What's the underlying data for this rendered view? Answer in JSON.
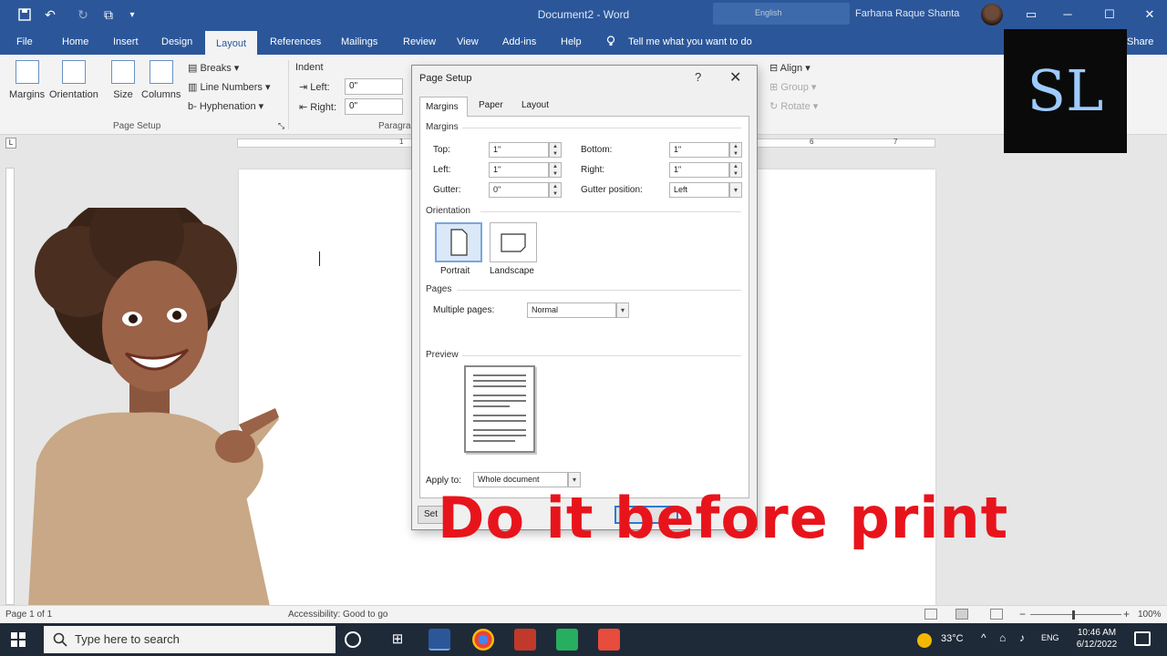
{
  "window": {
    "doc_title": "Document2  -  Word",
    "search_hint": "English",
    "user_name": "Farhana Raque Shanta",
    "minimize": "─",
    "restore": "☐",
    "close": "✕"
  },
  "tabs": [
    "File",
    "Home",
    "Insert",
    "Design",
    "Layout",
    "References",
    "Mailings",
    "Review",
    "View",
    "Add-ins",
    "Help"
  ],
  "tell_me": "Tell me what you want to do",
  "share": "Share",
  "ribbon": {
    "margins": "Margins",
    "orientation": "Orientation",
    "size": "Size",
    "columns": "Columns",
    "breaks": "Breaks",
    "line_numbers": "Line Numbers",
    "hyphenation": "Hyphenation",
    "page_setup_group": "Page Setup",
    "indent": "Indent",
    "left_label": "Left:",
    "left_value": "0\"",
    "right_label": "Right:",
    "right_value": "0\"",
    "paragraph_group": "Paragra",
    "align": "Align",
    "group": "Group",
    "rotate": "Rotate"
  },
  "ruler": {
    "n1": "1",
    "n6": "6",
    "n7": "7"
  },
  "dialog": {
    "title": "Page Setup",
    "help": "?",
    "close": "✕",
    "tabs": {
      "margins": "Margins",
      "paper": "Paper",
      "layout": "Layout"
    },
    "margins_section": "Margins",
    "top_label": "Top:",
    "top_value": "1\"",
    "bottom_label": "Bottom:",
    "bottom_value": "1\"",
    "left_label": "Left:",
    "left_value": "1\"",
    "right_label": "Right:",
    "right_value": "1\"",
    "gutter_label": "Gutter:",
    "gutter_value": "0\"",
    "gutter_pos_label": "Gutter position:",
    "gutter_pos_value": "Left",
    "orientation_section": "Orientation",
    "portrait": "Portrait",
    "landscape": "Landscape",
    "pages_section": "Pages",
    "multiple_pages_label": "Multiple pages:",
    "multiple_pages_value": "Normal",
    "preview_section": "Preview",
    "apply_to_label": "Apply to:",
    "apply_to_value": "Whole document",
    "set_default": "Set"
  },
  "logo_text": "SL",
  "overlay_text": "Do it before print",
  "status": {
    "page_count": "Page 1 of 1",
    "accessibility": "Accessibility: Good to go",
    "zoom": "100%"
  },
  "taskbar": {
    "search_placeholder": "Type here to search",
    "temperature": "33°C",
    "language": "ENG",
    "time": "10:46 AM",
    "date": "6/12/2022"
  },
  "colors": {
    "word_blue": "#2b579a",
    "overlay_red": "#e8141c"
  }
}
